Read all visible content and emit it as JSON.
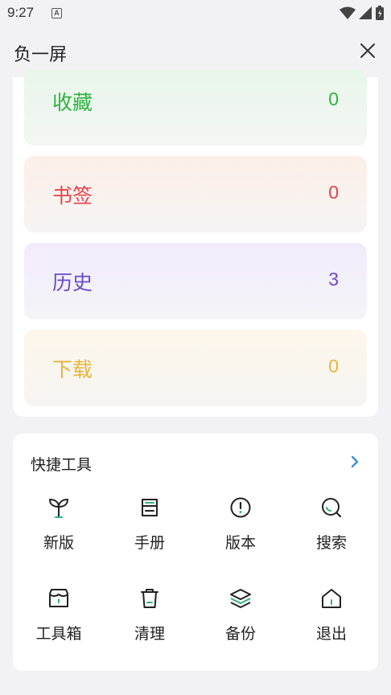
{
  "status_bar": {
    "time": "9:27",
    "notification_glyph": "A"
  },
  "header": {
    "title": "负一屏"
  },
  "stats": [
    {
      "label": "收藏",
      "count": "0",
      "color": "#2db341",
      "bg_from": "#e8f6ea",
      "bg_to": "#f4f6f4"
    },
    {
      "label": "书签",
      "count": "0",
      "color": "#e8424c",
      "bg_from": "#fcefe8",
      "bg_to": "#f6f4f4"
    },
    {
      "label": "历史",
      "count": "3",
      "color": "#6a4bc4",
      "bg_from": "#f1ecfc",
      "bg_to": "#f4f4f7"
    },
    {
      "label": "下载",
      "count": "0",
      "color": "#e7b53c",
      "bg_from": "#fdf6ea",
      "bg_to": "#f6f5f3"
    }
  ],
  "tools": {
    "title": "快捷工具",
    "items": [
      {
        "label": "新版",
        "icon": "sprout-icon"
      },
      {
        "label": "手册",
        "icon": "book-icon"
      },
      {
        "label": "版本",
        "icon": "info-circle-icon"
      },
      {
        "label": "搜索",
        "icon": "search-icon"
      },
      {
        "label": "工具箱",
        "icon": "toolbox-icon"
      },
      {
        "label": "清理",
        "icon": "trash-icon"
      },
      {
        "label": "备份",
        "icon": "layers-icon"
      },
      {
        "label": "退出",
        "icon": "home-icon"
      }
    ]
  },
  "colors": {
    "accent": "#2db37a",
    "chevron": "#3d8fe0"
  }
}
